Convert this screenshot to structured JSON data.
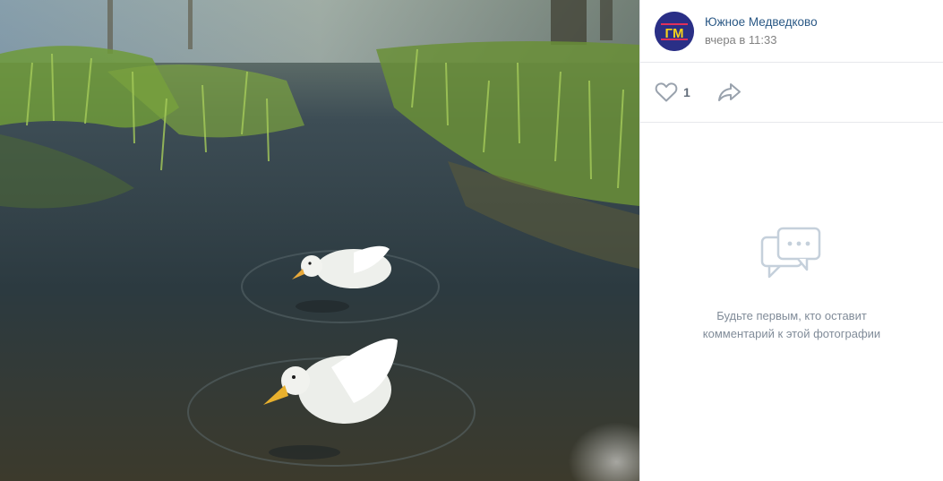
{
  "photo": {
    "alt_icon": "photo-duck-pond"
  },
  "author": {
    "avatar_text": "ГМ",
    "name": "Южное Медведково",
    "time": "вчера в 11:33"
  },
  "actions": {
    "like_icon": "heart-icon",
    "like_count": "1",
    "share_icon": "share-icon"
  },
  "comments": {
    "empty_icon": "comments-icon",
    "empty_text": "Будьте первым, кто оставит комментарий к этой фотографии"
  },
  "colors": {
    "link": "#2a5885",
    "muted": "#828282",
    "avatar_bg": "#2a2f86",
    "avatar_text": "#f5d21a",
    "avatar_accent": "#e0305a"
  }
}
